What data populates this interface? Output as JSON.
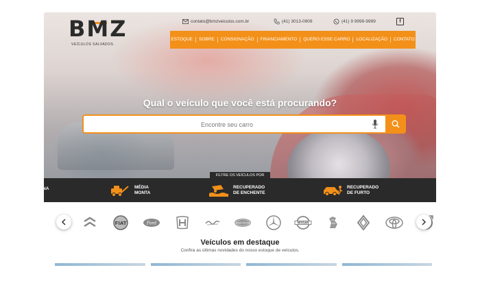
{
  "brand": {
    "logo": "BMZ",
    "tagline": "VEÍCULOS SALVADOS"
  },
  "contact": {
    "email": "contato@bmzveiculos.com.br",
    "phone": "(41) 3013-0909",
    "whatsapp": "(41) 9 9999-9999"
  },
  "nav": {
    "items": [
      "ESTOQUE",
      "SOBRE",
      "CONSIGNAÇÃO",
      "FINANCIAMENTO",
      "QUERO ESSE CARRO",
      "LOCALIZAÇÃO",
      "CONTATO"
    ]
  },
  "hero": {
    "title": "Qual o veículo que você está procurando?",
    "search_placeholder": "Encontre seu carro"
  },
  "filter": {
    "tab_label": "FILTRE OS VEÍCULOS POR",
    "cut_label": "NA",
    "items": [
      {
        "line1": "MÉDIA",
        "line2": "MONTA"
      },
      {
        "line1": "RECUPERADO",
        "line2": "DE ENCHENTE"
      },
      {
        "line1": "RECUPERADO",
        "line2": "DE FURTO"
      }
    ]
  },
  "brands": [
    "citroen-icon",
    "fiat-icon",
    "ford-icon",
    "honda-icon",
    "lamborghini-icon",
    "land-rover-icon",
    "mercedes-icon",
    "nissan-icon",
    "peugeot-icon",
    "renault-icon",
    "toyota-icon",
    "volvo-icon"
  ],
  "featured": {
    "title": "Veículos em destaque",
    "subtitle": "Confira as últimas novidades do nosso estoque de veículos."
  },
  "colors": {
    "accent": "#f39019",
    "dark": "#2a2a2a"
  }
}
